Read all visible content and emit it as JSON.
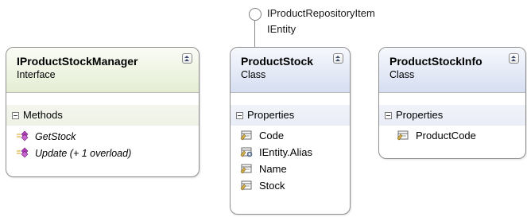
{
  "lollipop": {
    "interfaces": [
      "IProductRepositoryItem",
      "IEntity"
    ]
  },
  "shapes": [
    {
      "title": "IProductStockManager",
      "stereotype": "Interface",
      "section": "Methods",
      "members": [
        "GetStock",
        "Update (+ 1 overload)"
      ]
    },
    {
      "title": "ProductStock",
      "stereotype": "Class",
      "section": "Properties",
      "members": [
        "Code",
        "IEntity.Alias",
        "Name",
        "Stock"
      ]
    },
    {
      "title": "ProductStockInfo",
      "stereotype": "Class",
      "section": "Properties",
      "members": [
        "ProductCode"
      ]
    }
  ],
  "icons": {
    "method": "method-icon",
    "property": "property-icon",
    "explicit_property": "explicit-property-icon",
    "collapse": "collapse-chevron-icon",
    "section_toggle": "minus-icon"
  },
  "colors": {
    "interface_header": "#e4edd3",
    "class_header": "#d6def1",
    "method_icon": "#b03fb8",
    "border": "#8e8e8e"
  }
}
